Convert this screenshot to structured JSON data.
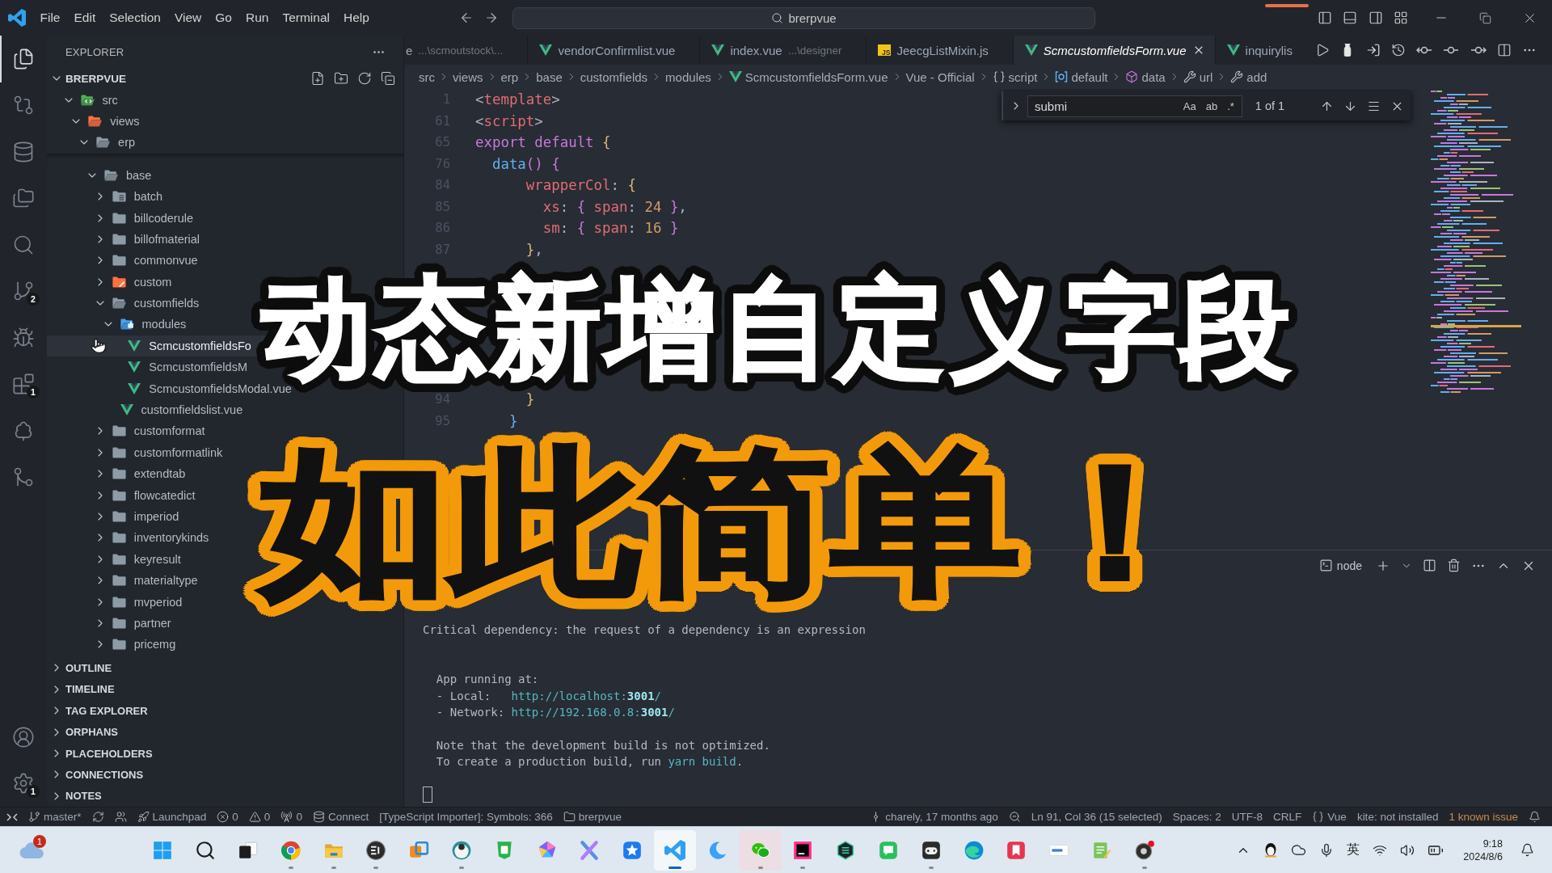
{
  "title_bar": {
    "menu": [
      "File",
      "Edit",
      "Selection",
      "View",
      "Go",
      "Run",
      "Terminal",
      "Help"
    ],
    "command_center": "brerpvue"
  },
  "activity_bar": {
    "items": [
      {
        "kind": "files",
        "selected": true
      },
      {
        "kind": "compare",
        "selected": false
      },
      {
        "kind": "database",
        "selected": false
      },
      {
        "kind": "folders",
        "selected": false
      },
      {
        "kind": "search",
        "selected": false
      },
      {
        "kind": "source-control",
        "selected": false,
        "badge": "2"
      },
      {
        "kind": "run-debug",
        "selected": false
      },
      {
        "kind": "extensions",
        "selected": false,
        "badge": "1"
      },
      {
        "kind": "tree",
        "selected": false
      },
      {
        "kind": "git-graph",
        "selected": false
      }
    ],
    "bottom": [
      {
        "kind": "account"
      },
      {
        "kind": "settings",
        "badge": "1"
      }
    ]
  },
  "sidebar": {
    "title": "EXPLORER",
    "root": {
      "label": "BRERPVUE",
      "expanded": true
    },
    "tree": [
      {
        "label": "src",
        "kind": "folder-src",
        "expanded": true,
        "selected": false,
        "children": [
          {
            "label": "views",
            "kind": "folder-views",
            "expanded": true,
            "selected": false,
            "children": [
              {
                "label": "erp",
                "kind": "folder",
                "expanded": true,
                "selected": false,
                "children": [
                  {
                    "label": "base",
                    "kind": "folder",
                    "expanded": true,
                    "selected": false,
                    "children": [
                      {
                        "label": "batch",
                        "kind": "folder-batch",
                        "expanded": false,
                        "selected": false
                      },
                      {
                        "label": "billcoderule",
                        "kind": "folder",
                        "expanded": false,
                        "selected": false
                      },
                      {
                        "label": "billofmaterial",
                        "kind": "folder",
                        "expanded": false,
                        "selected": false
                      },
                      {
                        "label": "commonvue",
                        "kind": "folder",
                        "expanded": false,
                        "selected": false
                      },
                      {
                        "label": "custom",
                        "kind": "folder-custom",
                        "expanded": false,
                        "selected": false
                      },
                      {
                        "label": "customfields",
                        "kind": "folder",
                        "expanded": true,
                        "selected": false,
                        "children": [
                          {
                            "label": "modules",
                            "kind": "folder-modules",
                            "expanded": true,
                            "selected": false,
                            "children": [
                              {
                                "label": "ScmcustomfieldsFo",
                                "kind": "vue-file",
                                "selected": true
                              },
                              {
                                "label": "ScmcustomfieldsM",
                                "kind": "vue-file",
                                "selected": false
                              },
                              {
                                "label": "ScmcustomfieldsModal.vue",
                                "kind": "vue-file",
                                "selected": false
                              }
                            ]
                          },
                          {
                            "label": "customfieldslist.vue",
                            "kind": "vue-file",
                            "selected": false
                          }
                        ]
                      },
                      {
                        "label": "customformat",
                        "kind": "folder",
                        "expanded": false,
                        "selected": false
                      },
                      {
                        "label": "customformatlink",
                        "kind": "folder",
                        "expanded": false,
                        "selected": false
                      },
                      {
                        "label": "extendtab",
                        "kind": "folder",
                        "expanded": false,
                        "selected": false
                      },
                      {
                        "label": "flowcatedict",
                        "kind": "folder",
                        "expanded": false,
                        "selected": false
                      },
                      {
                        "label": "imperiod",
                        "kind": "folder",
                        "expanded": false,
                        "selected": false
                      },
                      {
                        "label": "inventorykinds",
                        "kind": "folder",
                        "expanded": false,
                        "selected": false
                      },
                      {
                        "label": "keyresult",
                        "kind": "folder",
                        "expanded": false,
                        "selected": false
                      },
                      {
                        "label": "materialtype",
                        "kind": "folder",
                        "expanded": false,
                        "selected": false
                      },
                      {
                        "label": "mvperiod",
                        "kind": "folder",
                        "expanded": false,
                        "selected": false
                      },
                      {
                        "label": "partner",
                        "kind": "folder",
                        "expanded": false,
                        "selected": false
                      },
                      {
                        "label": "pricemg",
                        "kind": "folder",
                        "expanded": false,
                        "selected": false
                      }
                    ]
                  }
                ]
              }
            ]
          }
        ]
      }
    ],
    "sections": [
      {
        "label": "OUTLINE",
        "expanded": false
      },
      {
        "label": "TIMELINE",
        "expanded": false
      },
      {
        "label": "TAG EXPLORER",
        "expanded": false
      },
      {
        "label": "ORPHANS",
        "expanded": false
      },
      {
        "label": "PLACEHOLDERS",
        "expanded": false
      },
      {
        "label": "CONNECTIONS",
        "expanded": false
      },
      {
        "label": "NOTES",
        "expanded": false
      }
    ]
  },
  "editor": {
    "tabs": [
      {
        "label": "e",
        "description": "...\\scmoutstock\\...",
        "kind": "none",
        "selected": false,
        "preview": false
      },
      {
        "label": "vendorConfirmlist.vue",
        "kind": "vue",
        "selected": false,
        "preview": false
      },
      {
        "label": "index.vue",
        "description": "...\\designer",
        "kind": "vue",
        "selected": false,
        "preview": false
      },
      {
        "label": "JeecgListMixin.js",
        "kind": "js",
        "icon_label": "JS",
        "selected": false,
        "preview": false
      },
      {
        "label": "ScmcustomfieldsForm.vue",
        "kind": "vue",
        "selected": true,
        "preview": true
      },
      {
        "label": "inquirylis",
        "kind": "vue",
        "selected": false,
        "preview": false
      }
    ],
    "breadcrumb": [
      {
        "label": "src",
        "kind": "text"
      },
      {
        "label": "views",
        "kind": "text"
      },
      {
        "label": "erp",
        "kind": "text"
      },
      {
        "label": "base",
        "kind": "text"
      },
      {
        "label": "customfields",
        "kind": "text"
      },
      {
        "label": "modules",
        "kind": "text"
      },
      {
        "label": "ScmcustomfieldsForm.vue",
        "kind": "vue-file"
      },
      {
        "label": "Vue - Official",
        "kind": "text"
      },
      {
        "label": "script",
        "kind": "braces"
      },
      {
        "label": "default",
        "kind": "module"
      },
      {
        "label": "data",
        "kind": "cube"
      },
      {
        "label": "url",
        "kind": "wrench"
      },
      {
        "label": "add",
        "kind": "wrench"
      }
    ],
    "find": {
      "query": "submi",
      "options": [
        "Aa",
        "ab",
        ".*"
      ],
      "result": "1 of 1"
    },
    "lines": [
      {
        "number": "1",
        "tokens": [
          {
            "text": "<",
            "kind": "punct"
          },
          {
            "text": "template",
            "kind": "tag"
          },
          {
            "text": ">",
            "kind": "punct"
          }
        ]
      },
      {
        "number": "61",
        "tokens": [
          {
            "text": "<",
            "kind": "punct"
          },
          {
            "text": "script",
            "kind": "tag"
          },
          {
            "text": ">",
            "kind": "punct"
          }
        ]
      },
      {
        "number": "65",
        "tokens": [
          {
            "text": "export default",
            "kind": "keyword"
          },
          {
            "text": " {",
            "kind": "bracket-1"
          }
        ]
      },
      {
        "number": "76",
        "tokens": [
          {
            "text": "  data",
            "kind": "function"
          },
          {
            "text": "()",
            "kind": "bracket-2"
          },
          {
            "text": " {",
            "kind": "bracket-2"
          }
        ]
      },
      {
        "number": "84",
        "tokens": [
          {
            "text": "      wrapperCol",
            "kind": "property"
          },
          {
            "text": ":",
            "kind": "punct"
          },
          {
            "text": " {",
            "kind": "bracket-1"
          }
        ]
      },
      {
        "number": "85",
        "tokens": [
          {
            "text": "        xs",
            "kind": "property"
          },
          {
            "text": ":",
            "kind": "punct"
          },
          {
            "text": " {",
            "kind": "bracket-2"
          },
          {
            "text": " span",
            "kind": "property"
          },
          {
            "text": ":",
            "kind": "punct"
          },
          {
            "text": " 24",
            "kind": "number"
          },
          {
            "text": " }",
            "kind": "bracket-2"
          },
          {
            "text": ",",
            "kind": "punct"
          }
        ]
      },
      {
        "number": "86",
        "tokens": [
          {
            "text": "        sm",
            "kind": "property"
          },
          {
            "text": ":",
            "kind": "punct"
          },
          {
            "text": " {",
            "kind": "bracket-2"
          },
          {
            "text": " span",
            "kind": "property"
          },
          {
            "text": ":",
            "kind": "punct"
          },
          {
            "text": " 16",
            "kind": "number"
          },
          {
            "text": " }",
            "kind": "bracket-2"
          }
        ]
      },
      {
        "number": "87",
        "tokens": [
          {
            "text": "      }",
            "kind": "bracket-1"
          },
          {
            "text": ",",
            "kind": "punct"
          }
        ]
      }
    ],
    "lines_below_caption": [
      {
        "number": "94",
        "tokens": [
          {
            "text": "      }",
            "kind": "bracket-1"
          }
        ]
      },
      {
        "number": "95",
        "tokens": [
          {
            "text": "    }",
            "kind": "bracket-3"
          }
        ]
      }
    ]
  },
  "panel": {
    "terminal": {
      "name": "node",
      "warning": "Critical dependency: the request of a dependency is an expression",
      "server_heading": "App running at:",
      "urls": [
        {
          "label": "- Local:",
          "url": "http://localhost:**3001**/"
        },
        {
          "label": "- Network:",
          "url": "http://192.168.0.8:**3001**/"
        }
      ],
      "note": "Note that the development build is not optimized.",
      "hint": {
        "text": "To create a production build, run ",
        "command": "yarn build",
        "end": "."
      }
    }
  },
  "caption": {
    "title": "动态新增自定义字段",
    "subtitle": "如此简单！"
  },
  "status_bar": {
    "left": [
      {
        "kind": "remote"
      },
      {
        "kind": "branch",
        "text": "master*"
      },
      {
        "kind": "sync"
      },
      {
        "kind": "people"
      },
      {
        "kind": "rocket",
        "text": "Launchpad"
      },
      {
        "kind": "errors",
        "text": "0"
      },
      {
        "kind": "warnings",
        "text": "0"
      },
      {
        "kind": "ports",
        "text": "0"
      },
      {
        "kind": "database",
        "text": "Connect"
      },
      {
        "kind": "plain",
        "text": "[TypeScript Importer]: Symbols: 366"
      },
      {
        "kind": "folder",
        "text": "brerpvue"
      }
    ],
    "right": [
      {
        "kind": "commit",
        "text": "charely, 17 months ago"
      },
      {
        "kind": "zoom"
      },
      {
        "kind": "plain",
        "text": "Ln 91, Col 36 (15 selected)"
      },
      {
        "kind": "plain",
        "text": "Spaces: 2"
      },
      {
        "kind": "plain",
        "text": "UTF-8"
      },
      {
        "kind": "plain",
        "text": "CRLF"
      },
      {
        "kind": "braces",
        "text": "Vue"
      },
      {
        "kind": "plain",
        "text": "kite: not installed"
      },
      {
        "kind": "plain",
        "text": "1 known issue",
        "color": "#c98a4b"
      },
      {
        "kind": "bell"
      }
    ]
  },
  "taskbar": {
    "weather_badge": "1",
    "apps": [
      {
        "kind": "start",
        "running": false,
        "selected": false,
        "flashing": false
      },
      {
        "kind": "search",
        "running": false,
        "selected": false,
        "flashing": false
      },
      {
        "kind": "task-view",
        "running": false,
        "selected": false,
        "flashing": false
      },
      {
        "kind": "chrome",
        "running": true,
        "selected": false,
        "flashing": false
      },
      {
        "kind": "explorer",
        "running": true,
        "selected": false,
        "flashing": false
      },
      {
        "kind": "emblem",
        "running": true,
        "selected": false,
        "flashing": false
      },
      {
        "kind": "squares",
        "running": false,
        "selected": false,
        "flashing": false
      },
      {
        "kind": "mascot",
        "running": true,
        "selected": false,
        "flashing": false
      },
      {
        "kind": "square-app",
        "running": false,
        "selected": false,
        "flashing": false
      },
      {
        "kind": "hexagon",
        "running": false,
        "selected": false,
        "flashing": false
      },
      {
        "kind": "cross",
        "running": false,
        "selected": false,
        "flashing": false
      },
      {
        "kind": "star",
        "running": false,
        "selected": false,
        "flashing": false
      },
      {
        "kind": "code-editor",
        "running": true,
        "selected": true,
        "flashing": false
      },
      {
        "kind": "crescent",
        "running": false,
        "selected": false,
        "flashing": false
      },
      {
        "kind": "chat",
        "running": true,
        "selected": false,
        "flashing": true
      },
      {
        "kind": "gradient-square",
        "running": true,
        "selected": false,
        "flashing": false
      },
      {
        "kind": "hex-badge",
        "running": false,
        "selected": false,
        "flashing": false
      },
      {
        "kind": "message-tile",
        "running": false,
        "selected": false,
        "flashing": false
      },
      {
        "kind": "gamepad",
        "running": true,
        "selected": false,
        "flashing": false
      },
      {
        "kind": "wave",
        "running": false,
        "selected": false,
        "flashing": false
      },
      {
        "kind": "bookmark",
        "running": false,
        "selected": false,
        "flashing": false
      },
      {
        "kind": "card",
        "running": false,
        "selected": false,
        "flashing": false
      },
      {
        "kind": "notepad",
        "running": false,
        "selected": false,
        "flashing": false
      },
      {
        "kind": "record",
        "running": true,
        "selected": false,
        "flashing": false
      }
    ],
    "tray": {
      "input_method": "英",
      "time": "9:18",
      "date": "2024/8/6"
    }
  }
}
